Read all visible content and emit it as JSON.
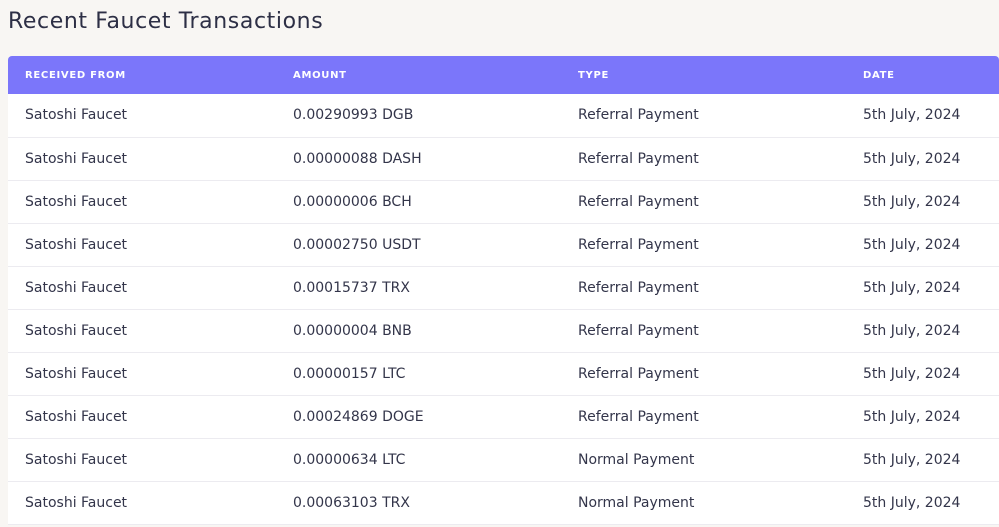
{
  "page": {
    "title": "Recent Faucet Transactions"
  },
  "table": {
    "headers": {
      "received_from": "RECEIVED FROM",
      "amount": "AMOUNT",
      "type": "TYPE",
      "date": "DATE"
    },
    "rows": [
      {
        "received_from": "Satoshi Faucet",
        "amount": "0.00290993 DGB",
        "type": "Referral Payment",
        "date": "5th July, 2024"
      },
      {
        "received_from": "Satoshi Faucet",
        "amount": "0.00000088 DASH",
        "type": "Referral Payment",
        "date": "5th July, 2024"
      },
      {
        "received_from": "Satoshi Faucet",
        "amount": "0.00000006 BCH",
        "type": "Referral Payment",
        "date": "5th July, 2024"
      },
      {
        "received_from": "Satoshi Faucet",
        "amount": "0.00002750 USDT",
        "type": "Referral Payment",
        "date": "5th July, 2024"
      },
      {
        "received_from": "Satoshi Faucet",
        "amount": "0.00015737 TRX",
        "type": "Referral Payment",
        "date": "5th July, 2024"
      },
      {
        "received_from": "Satoshi Faucet",
        "amount": "0.00000004 BNB",
        "type": "Referral Payment",
        "date": "5th July, 2024"
      },
      {
        "received_from": "Satoshi Faucet",
        "amount": "0.00000157 LTC",
        "type": "Referral Payment",
        "date": "5th July, 2024"
      },
      {
        "received_from": "Satoshi Faucet",
        "amount": "0.00024869 DOGE",
        "type": "Referral Payment",
        "date": "5th July, 2024"
      },
      {
        "received_from": "Satoshi Faucet",
        "amount": "0.00000634 LTC",
        "type": "Normal Payment",
        "date": "5th July, 2024"
      },
      {
        "received_from": "Satoshi Faucet",
        "amount": "0.00063103 TRX",
        "type": "Normal Payment",
        "date": "5th July, 2024"
      }
    ]
  }
}
